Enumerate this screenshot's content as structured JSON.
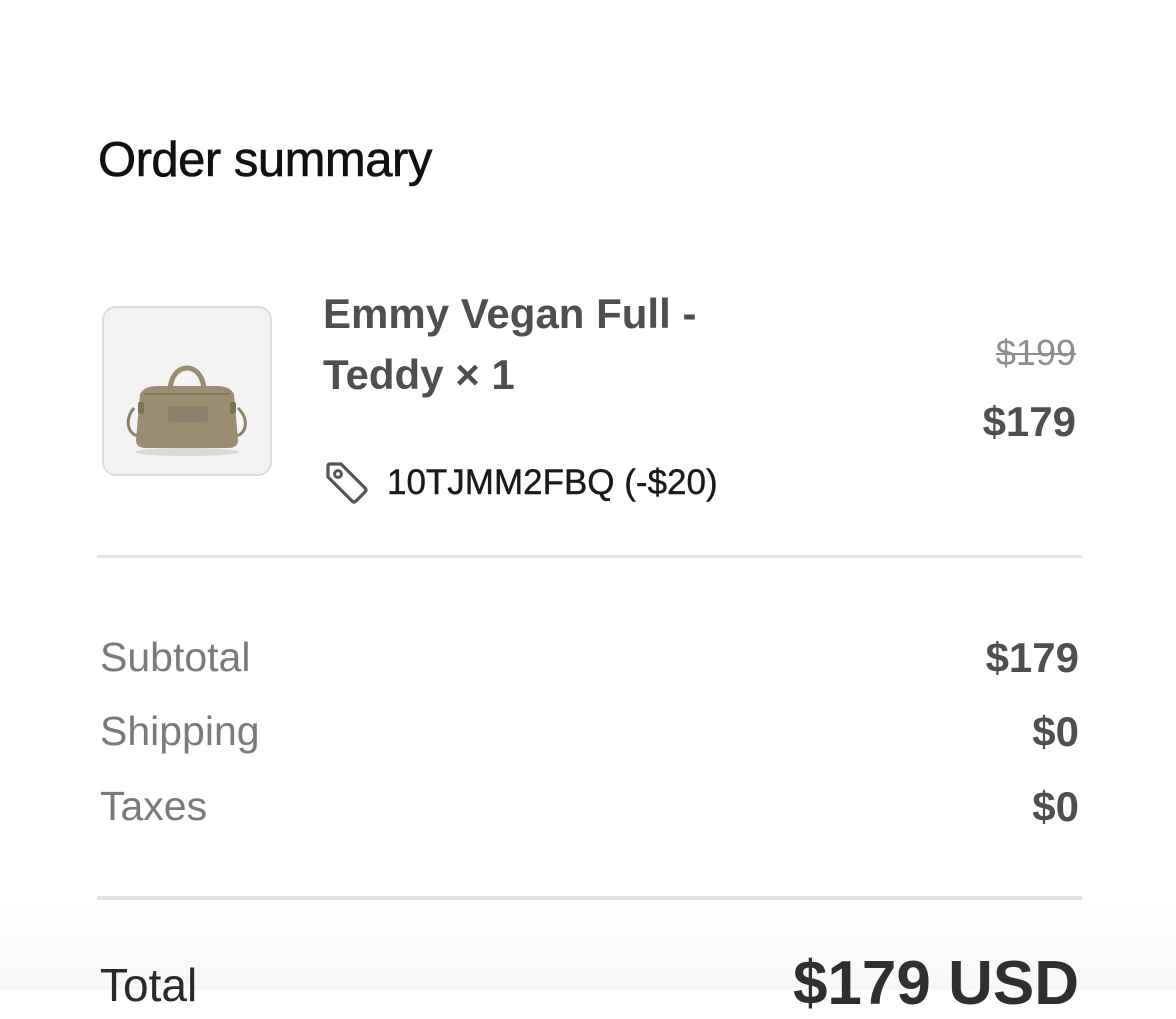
{
  "summary": {
    "title": "Order summary"
  },
  "line_item": {
    "image_icon": "duffel-bag-product-image",
    "name": "Emmy Vegan Full - Teddy × 1",
    "discount_icon": "tag-icon",
    "discount_code": "10TJMM2FBQ (-$20)",
    "original_price": "$199",
    "final_price": "$179"
  },
  "totals": {
    "rows": [
      {
        "label": "Subtotal",
        "value": "$179"
      },
      {
        "label": "Shipping",
        "value": "$0"
      },
      {
        "label": "Taxes",
        "value": "$0"
      }
    ],
    "total_label": "Total",
    "total_value": "$179 USD"
  },
  "colors": {
    "background": "#ffffff",
    "title_text": "#111111",
    "emphasis_text": "#4f4f4f",
    "muted_text": "#7a7a7a",
    "strikethrough_text": "#8e8e8e",
    "divider": "#e3e3e3",
    "bag": "#9b8d74"
  }
}
